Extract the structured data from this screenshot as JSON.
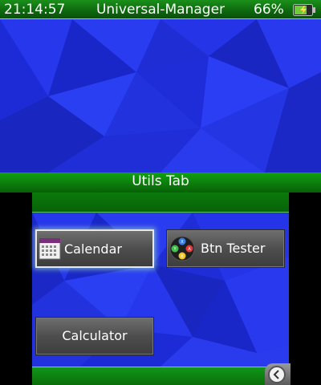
{
  "status_bar": {
    "time": "21:14:57",
    "title": "Universal-Manager",
    "battery_percent": "66%"
  },
  "tab": {
    "title": "Utils Tab"
  },
  "apps": {
    "calendar_label": "Calendar",
    "btn_tester_label": "Btn Tester",
    "calculator_label": "Calculator"
  },
  "icons": {
    "battery": "battery-charging-icon",
    "calendar": "calendar-icon",
    "btn_tester": "gamepad-buttons-icon",
    "back": "chevron-left-icon"
  },
  "colors": {
    "accent_green": "#0e7f0e",
    "background_blue": "#1f2de0",
    "button_gray": "#4e4e4e",
    "selection_white": "#e8e8e8"
  },
  "state": {
    "selected_app": "calendar"
  }
}
